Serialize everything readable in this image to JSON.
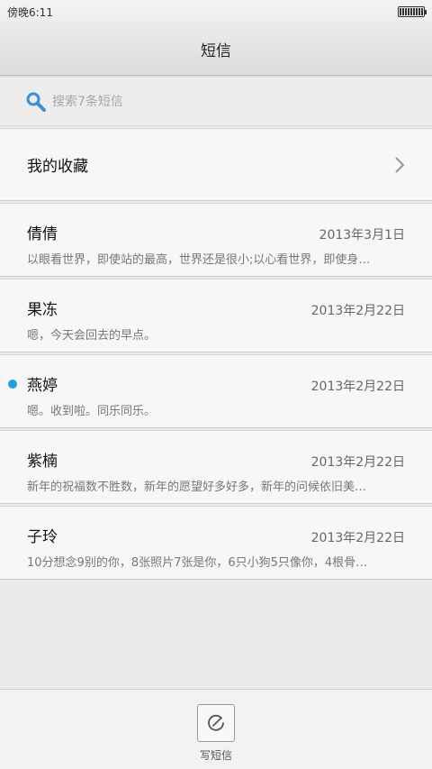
{
  "status_bar": {
    "time": "傍晚6:11"
  },
  "header": {
    "title": "短信"
  },
  "search": {
    "placeholder": "搜索7条短信"
  },
  "favorites": {
    "label": "我的收藏"
  },
  "messages": [
    {
      "name": "倩倩",
      "date": "2013年3月1日",
      "preview": "以眼看世界，即使站的最高，世界还是很小;以心看世界，即使身…",
      "unread": false
    },
    {
      "name": "果冻",
      "date": "2013年2月22日",
      "preview": "嗯，今天会回去的早点。",
      "unread": false
    },
    {
      "name": "燕婷",
      "date": "2013年2月22日",
      "preview": "嗯。收到啦。同乐同乐。",
      "unread": true
    },
    {
      "name": "紫楠",
      "date": "2013年2月22日",
      "preview": "新年的祝福数不胜数，新年的愿望好多好多，新年的问候依旧美…",
      "unread": false
    },
    {
      "name": "子玲",
      "date": "2013年2月22日",
      "preview": "10分想念9别的你，8张照片7张是你，6只小狗5只像你，4根骨…",
      "unread": false
    }
  ],
  "bottom_bar": {
    "compose_label": "写短信"
  },
  "colors": {
    "unread_dot": "#1ca2e4",
    "search_icon": "#3a8fd6"
  }
}
